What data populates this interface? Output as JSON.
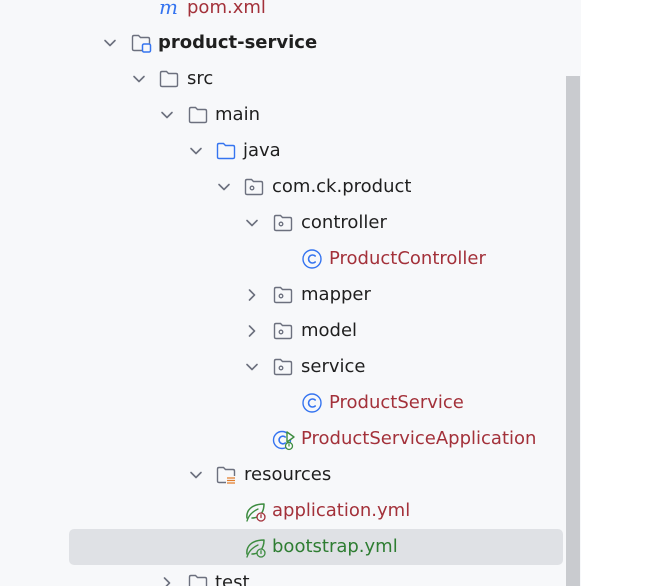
{
  "tree": {
    "pom": {
      "label": "pom.xml",
      "icon_letter": "m"
    },
    "product_service": {
      "label": "product-service"
    },
    "src": {
      "label": "src"
    },
    "main": {
      "label": "main"
    },
    "java": {
      "label": "java"
    },
    "package": {
      "label": "com.ck.product"
    },
    "controller": {
      "label": "controller"
    },
    "product_controller": {
      "label": "ProductController"
    },
    "mapper": {
      "label": "mapper"
    },
    "model": {
      "label": "model"
    },
    "service": {
      "label": "service"
    },
    "product_service_class": {
      "label": "ProductService"
    },
    "app": {
      "label": "ProductServiceApplication"
    },
    "resources": {
      "label": "resources"
    },
    "application_yml": {
      "label": "application.yml"
    },
    "bootstrap_yml": {
      "label": "bootstrap.yml"
    },
    "test": {
      "label": "test"
    }
  },
  "colors": {
    "panel_bg": "#f7f8fa",
    "selected_bg": "#dfe1e5",
    "modified_text": "#a3313a",
    "new_file_text": "#2e7d32",
    "class_icon": "#3574f0",
    "spring_icon": "#3d8c40"
  },
  "icons": {
    "expanded": "chevron-down-icon",
    "collapsed": "chevron-right-icon",
    "folder": "folder-icon",
    "module": "module-folder-icon",
    "source_root": "source-root-icon",
    "package": "package-icon",
    "resources_root": "resources-root-icon",
    "class": "class-icon",
    "spring_boot_app": "spring-boot-application-icon",
    "spring_yml": "spring-config-icon",
    "maven": "maven-icon"
  }
}
